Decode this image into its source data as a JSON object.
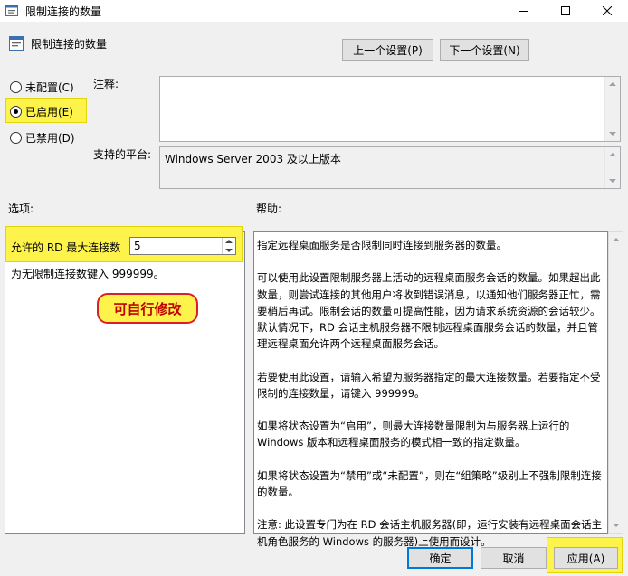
{
  "window": {
    "title": "限制连接的数量",
    "icon": "policy-icon",
    "controls": [
      "minimize-icon",
      "maximize-icon",
      "close-icon"
    ]
  },
  "header": {
    "title": "限制连接的数量",
    "prev_button": "上一个设置(P)",
    "next_button": "下一个设置(N)"
  },
  "state": {
    "options": [
      {
        "label": "未配置(C)",
        "selected": false
      },
      {
        "label": "已启用(E)",
        "selected": true
      },
      {
        "label": "已禁用(D)",
        "selected": false
      }
    ]
  },
  "comment": {
    "label": "注释:",
    "value": ""
  },
  "platform": {
    "label": "支持的平台:",
    "value": "Windows Server 2003 及以上版本"
  },
  "options_section": {
    "label": "选项:",
    "max_connections_label": "允许的 RD 最大连接数",
    "max_connections_value": "5",
    "hint": "为无限制连接数键入 999999。"
  },
  "annotation": {
    "text": "可自行修改"
  },
  "help_section": {
    "label": "帮助:",
    "paragraphs": [
      "指定远程桌面服务是否限制同时连接到服务器的数量。",
      "可以使用此设置限制服务器上活动的远程桌面服务会话的数量。如果超出此数量，则尝试连接的其他用户将收到错误消息，以通知他们服务器正忙，需要稍后再试。限制会话的数量可提高性能，因为请求系统资源的会话较少。默认情况下，RD 会话主机服务器不限制远程桌面服务会话的数量，并且管理远程桌面允许两个远程桌面服务会话。",
      "若要使用此设置，请输入希望为服务器指定的最大连接数量。若要指定不受限制的连接数量，请键入 999999。",
      "如果将状态设置为“启用”，则最大连接数量限制为与服务器上运行的 Windows 版本和远程桌面服务的模式相一致的指定数量。",
      "如果将状态设置为“禁用”或“未配置”，则在“组策略”级别上不强制限制连接的数量。",
      "注意: 此设置专门为在 RD 会话主机服务器(即，运行安装有远程桌面会话主机角色服务的 Windows 的服务器)上使用而设计。"
    ]
  },
  "footer": {
    "ok": "确定",
    "cancel": "取消",
    "apply": "应用(A)"
  },
  "colors": {
    "highlight": "#fdf34a",
    "accent": "#0078d7",
    "annotation_text": "#c00000"
  }
}
